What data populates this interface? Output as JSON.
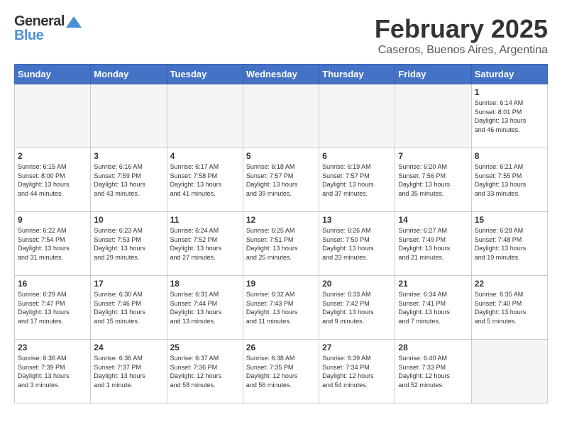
{
  "header": {
    "logo_general": "General",
    "logo_blue": "Blue",
    "month_title": "February 2025",
    "location": "Caseros, Buenos Aires, Argentina"
  },
  "weekdays": [
    "Sunday",
    "Monday",
    "Tuesday",
    "Wednesday",
    "Thursday",
    "Friday",
    "Saturday"
  ],
  "weeks": [
    [
      {
        "day": "",
        "info": ""
      },
      {
        "day": "",
        "info": ""
      },
      {
        "day": "",
        "info": ""
      },
      {
        "day": "",
        "info": ""
      },
      {
        "day": "",
        "info": ""
      },
      {
        "day": "",
        "info": ""
      },
      {
        "day": "1",
        "info": "Sunrise: 6:14 AM\nSunset: 8:01 PM\nDaylight: 13 hours\nand 46 minutes."
      }
    ],
    [
      {
        "day": "2",
        "info": "Sunrise: 6:15 AM\nSunset: 8:00 PM\nDaylight: 13 hours\nand 44 minutes."
      },
      {
        "day": "3",
        "info": "Sunrise: 6:16 AM\nSunset: 7:59 PM\nDaylight: 13 hours\nand 43 minutes."
      },
      {
        "day": "4",
        "info": "Sunrise: 6:17 AM\nSunset: 7:58 PM\nDaylight: 13 hours\nand 41 minutes."
      },
      {
        "day": "5",
        "info": "Sunrise: 6:18 AM\nSunset: 7:57 PM\nDaylight: 13 hours\nand 39 minutes."
      },
      {
        "day": "6",
        "info": "Sunrise: 6:19 AM\nSunset: 7:57 PM\nDaylight: 13 hours\nand 37 minutes."
      },
      {
        "day": "7",
        "info": "Sunrise: 6:20 AM\nSunset: 7:56 PM\nDaylight: 13 hours\nand 35 minutes."
      },
      {
        "day": "8",
        "info": "Sunrise: 6:21 AM\nSunset: 7:55 PM\nDaylight: 13 hours\nand 33 minutes."
      }
    ],
    [
      {
        "day": "9",
        "info": "Sunrise: 6:22 AM\nSunset: 7:54 PM\nDaylight: 13 hours\nand 31 minutes."
      },
      {
        "day": "10",
        "info": "Sunrise: 6:23 AM\nSunset: 7:53 PM\nDaylight: 13 hours\nand 29 minutes."
      },
      {
        "day": "11",
        "info": "Sunrise: 6:24 AM\nSunset: 7:52 PM\nDaylight: 13 hours\nand 27 minutes."
      },
      {
        "day": "12",
        "info": "Sunrise: 6:25 AM\nSunset: 7:51 PM\nDaylight: 13 hours\nand 25 minutes."
      },
      {
        "day": "13",
        "info": "Sunrise: 6:26 AM\nSunset: 7:50 PM\nDaylight: 13 hours\nand 23 minutes."
      },
      {
        "day": "14",
        "info": "Sunrise: 6:27 AM\nSunset: 7:49 PM\nDaylight: 13 hours\nand 21 minutes."
      },
      {
        "day": "15",
        "info": "Sunrise: 6:28 AM\nSunset: 7:48 PM\nDaylight: 13 hours\nand 19 minutes."
      }
    ],
    [
      {
        "day": "16",
        "info": "Sunrise: 6:29 AM\nSunset: 7:47 PM\nDaylight: 13 hours\nand 17 minutes."
      },
      {
        "day": "17",
        "info": "Sunrise: 6:30 AM\nSunset: 7:46 PM\nDaylight: 13 hours\nand 15 minutes."
      },
      {
        "day": "18",
        "info": "Sunrise: 6:31 AM\nSunset: 7:44 PM\nDaylight: 13 hours\nand 13 minutes."
      },
      {
        "day": "19",
        "info": "Sunrise: 6:32 AM\nSunset: 7:43 PM\nDaylight: 13 hours\nand 11 minutes."
      },
      {
        "day": "20",
        "info": "Sunrise: 6:33 AM\nSunset: 7:42 PM\nDaylight: 13 hours\nand 9 minutes."
      },
      {
        "day": "21",
        "info": "Sunrise: 6:34 AM\nSunset: 7:41 PM\nDaylight: 13 hours\nand 7 minutes."
      },
      {
        "day": "22",
        "info": "Sunrise: 6:35 AM\nSunset: 7:40 PM\nDaylight: 13 hours\nand 5 minutes."
      }
    ],
    [
      {
        "day": "23",
        "info": "Sunrise: 6:36 AM\nSunset: 7:39 PM\nDaylight: 13 hours\nand 3 minutes."
      },
      {
        "day": "24",
        "info": "Sunrise: 6:36 AM\nSunset: 7:37 PM\nDaylight: 13 hours\nand 1 minute."
      },
      {
        "day": "25",
        "info": "Sunrise: 6:37 AM\nSunset: 7:36 PM\nDaylight: 12 hours\nand 58 minutes."
      },
      {
        "day": "26",
        "info": "Sunrise: 6:38 AM\nSunset: 7:35 PM\nDaylight: 12 hours\nand 56 minutes."
      },
      {
        "day": "27",
        "info": "Sunrise: 6:39 AM\nSunset: 7:34 PM\nDaylight: 12 hours\nand 54 minutes."
      },
      {
        "day": "28",
        "info": "Sunrise: 6:40 AM\nSunset: 7:33 PM\nDaylight: 12 hours\nand 52 minutes."
      },
      {
        "day": "",
        "info": ""
      }
    ]
  ]
}
